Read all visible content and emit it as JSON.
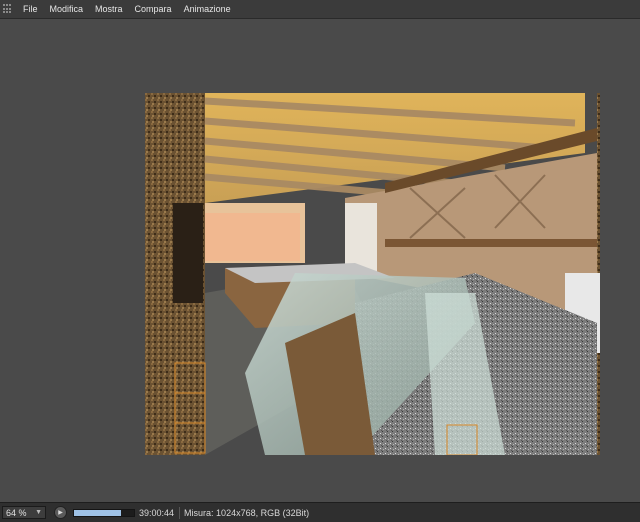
{
  "menu": {
    "items": [
      "File",
      "Modifica",
      "Mostra",
      "Compara",
      "Animazione"
    ]
  },
  "render": {
    "description_icon": "interior-render-image"
  },
  "status": {
    "zoom": "64 %",
    "time": "39:00:44",
    "info": "Misura: 1024x768, RGB (32Bit)",
    "progress": 0.78
  },
  "colors": {
    "background": "#4a4a4a",
    "menubar": "#3b3b3b",
    "statusbar": "#2f2f2f",
    "progress": "#9fc2e6"
  }
}
